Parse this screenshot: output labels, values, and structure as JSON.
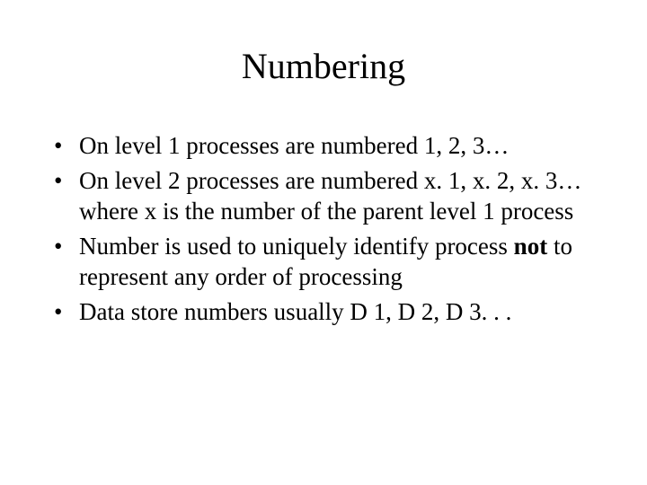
{
  "slide": {
    "title": "Numbering",
    "bullets": [
      {
        "text": "On level 1 processes are numbered 1, 2, 3…"
      },
      {
        "text": "On level 2 processes are numbered x. 1, x. 2, x. 3… where x is the number of the parent level 1 process"
      },
      {
        "pre": "Number is used to uniquely identify process ",
        "bold": "not",
        "post": " to represent any order of processing"
      },
      {
        "text": "Data store numbers usually D 1, D 2, D 3. . ."
      }
    ]
  }
}
